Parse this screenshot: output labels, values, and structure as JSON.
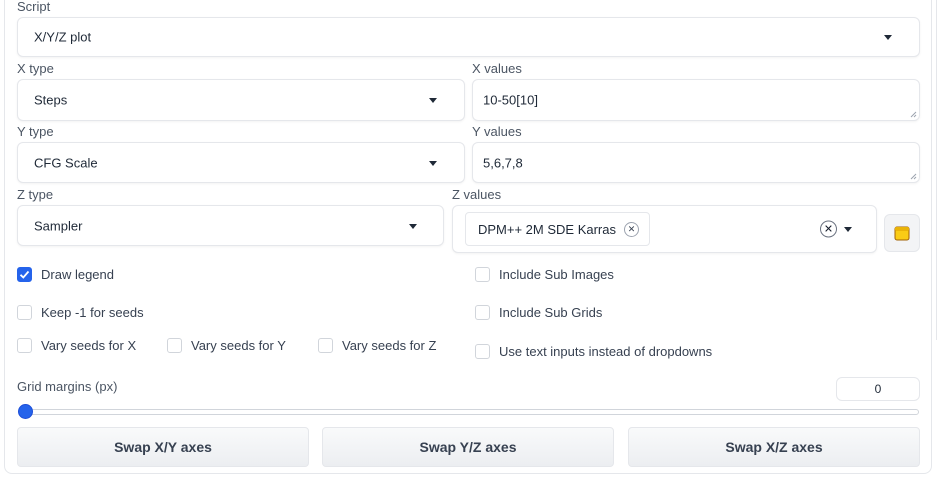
{
  "script": {
    "label": "Script",
    "value": "X/Y/Z plot"
  },
  "x": {
    "type_label": "X type",
    "type_value": "Steps",
    "values_label": "X values",
    "values": "10-50[10]"
  },
  "y": {
    "type_label": "Y type",
    "type_value": "CFG Scale",
    "values_label": "Y values",
    "values": "5,6,7,8"
  },
  "z": {
    "type_label": "Z type",
    "type_value": "Sampler",
    "values_label": "Z values",
    "chips": [
      "DPM++ 2M SDE Karras"
    ]
  },
  "checkboxes": {
    "draw_legend": {
      "label": "Draw legend",
      "checked": true
    },
    "include_sub_images": {
      "label": "Include Sub Images",
      "checked": false
    },
    "keep_seeds": {
      "label": "Keep -1 for seeds",
      "checked": false
    },
    "include_sub_grids": {
      "label": "Include Sub Grids",
      "checked": false
    },
    "vary_x": {
      "label": "Vary seeds for X",
      "checked": false
    },
    "vary_y": {
      "label": "Vary seeds for Y",
      "checked": false
    },
    "vary_z": {
      "label": "Vary seeds for Z",
      "checked": false
    },
    "text_inputs": {
      "label": "Use text inputs instead of dropdowns",
      "checked": false
    }
  },
  "grid_margins": {
    "label": "Grid margins (px)",
    "value": "0",
    "slider_fraction": 0
  },
  "buttons": {
    "swap_xy": "Swap X/Y axes",
    "swap_yz": "Swap Y/Z axes",
    "swap_xz": "Swap X/Z axes"
  },
  "colors": {
    "accent": "#2563eb",
    "border": "#e5e7eb",
    "folder": "#eab308"
  },
  "icons": {
    "dropdown": "chevron-down-icon",
    "remove": "close-icon",
    "folder": "folder-icon",
    "check": "checkmark-icon"
  }
}
